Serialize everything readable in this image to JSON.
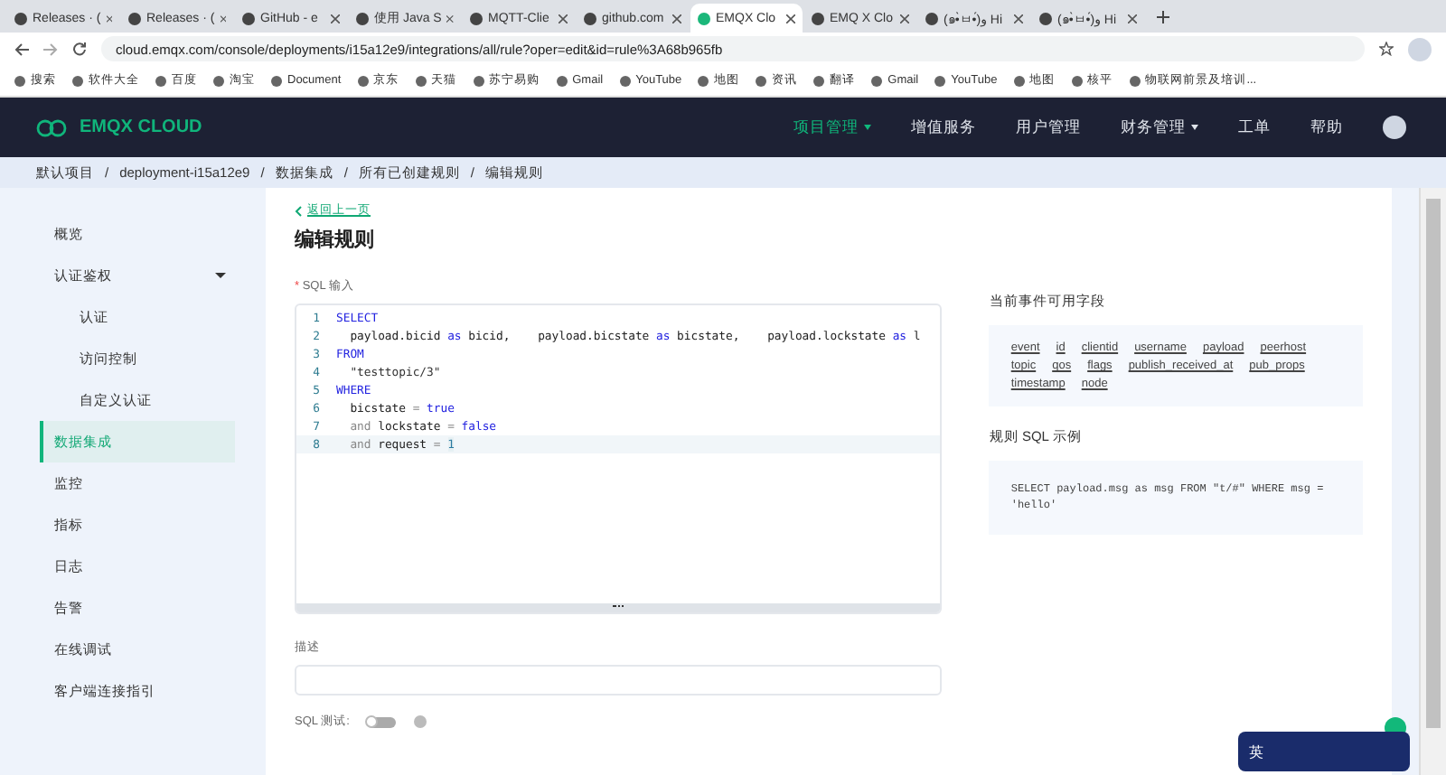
{
  "browser": {
    "tabs": [
      {
        "title": "Releases · (",
        "selected": false
      },
      {
        "title": "Releases · (",
        "selected": false
      },
      {
        "title": "GitHub - e",
        "selected": false
      },
      {
        "title": "使用 Java S",
        "selected": false
      },
      {
        "title": "MQTT-Clie",
        "selected": false
      },
      {
        "title": "github.com",
        "selected": false
      },
      {
        "title": "EMQX Clo",
        "selected": true
      },
      {
        "title": "EMQ X Clo",
        "selected": false
      },
      {
        "title": "(๑•̀ㅂ•́)و Hi",
        "selected": false
      },
      {
        "title": "(๑•̀ㅂ•́)و Hi",
        "selected": false
      }
    ],
    "url": "cloud.emqx.com/console/deployments/i15a12e9/integrations/all/rule?oper=edit&id=rule%3A68b965fb",
    "bookmarks": [
      "搜索",
      "软件大全",
      "百度",
      "淘宝",
      "Document",
      "京东",
      "天猫",
      "苏宁易购",
      "Gmail",
      "YouTube",
      "地图",
      "资讯",
      "翻译",
      "Gmail",
      "YouTube",
      "地图",
      "核平",
      "物联网前景及培训..."
    ]
  },
  "header": {
    "logo": "EMQX CLOUD",
    "nav": [
      {
        "label": "项目管理",
        "selected": true,
        "dropdown": true
      },
      {
        "label": "增值服务",
        "selected": false,
        "dropdown": false
      },
      {
        "label": "用户管理",
        "selected": false,
        "dropdown": false
      },
      {
        "label": "财务管理",
        "selected": false,
        "dropdown": true
      },
      {
        "label": "工单",
        "selected": false,
        "dropdown": false
      },
      {
        "label": "帮助",
        "selected": false,
        "dropdown": false
      }
    ]
  },
  "breadcrumb_separator": "/",
  "breadcrumb": [
    "默认项目",
    "deployment-i15a12e9",
    "数据集成",
    "所有已创建规则",
    "编辑规则"
  ],
  "sidebar": {
    "items": [
      {
        "label": "概览",
        "selected": false
      },
      {
        "label": "认证鉴权",
        "selected": false,
        "expanded": true,
        "children": [
          {
            "label": "认证",
            "selected": false
          },
          {
            "label": "访问控制",
            "selected": false
          },
          {
            "label": "自定义认证",
            "selected": false
          }
        ]
      },
      {
        "label": "数据集成",
        "selected": true
      },
      {
        "label": "监控",
        "selected": false
      },
      {
        "label": "指标",
        "selected": false
      },
      {
        "label": "日志",
        "selected": false
      },
      {
        "label": "告警",
        "selected": false
      },
      {
        "label": "在线调试",
        "selected": false
      },
      {
        "label": "客户端连接指引",
        "selected": false
      }
    ]
  },
  "page": {
    "back_link": "返回上一页",
    "title": "编辑规则",
    "sql_label": "SQL 输入",
    "required_mark": "*",
    "sql_lines": [
      {
        "number": "1",
        "tokens": [
          {
            "text": "SELECT",
            "kind": "keyword"
          }
        ]
      },
      {
        "number": "2",
        "tokens": [
          {
            "text": "  payload.bicid ",
            "kind": "plain"
          },
          {
            "text": "as",
            "kind": "keyword"
          },
          {
            "text": " bicid,    payload.bicstate ",
            "kind": "plain"
          },
          {
            "text": "as",
            "kind": "keyword"
          },
          {
            "text": " bicstate,    payload.lockstate ",
            "kind": "plain"
          },
          {
            "text": "as",
            "kind": "keyword"
          },
          {
            "text": " l",
            "kind": "plain"
          }
        ]
      },
      {
        "number": "3",
        "tokens": [
          {
            "text": "FROM",
            "kind": "keyword"
          }
        ]
      },
      {
        "number": "4",
        "tokens": [
          {
            "text": "  \"testtopic/3\"",
            "kind": "string"
          }
        ]
      },
      {
        "number": "5",
        "tokens": [
          {
            "text": "WHERE",
            "kind": "keyword"
          }
        ]
      },
      {
        "number": "6",
        "tokens": [
          {
            "text": "  bicstate ",
            "kind": "plain"
          },
          {
            "text": "= ",
            "kind": "operator"
          },
          {
            "text": "true",
            "kind": "keyword"
          }
        ]
      },
      {
        "number": "7",
        "tokens": [
          {
            "text": "  and",
            "kind": "operator"
          },
          {
            "text": " lockstate ",
            "kind": "plain"
          },
          {
            "text": "= ",
            "kind": "operator"
          },
          {
            "text": "false",
            "kind": "keyword"
          }
        ]
      },
      {
        "number": "8",
        "tokens": [
          {
            "text": "  and",
            "kind": "operator"
          },
          {
            "text": " request ",
            "kind": "plain"
          },
          {
            "text": "= ",
            "kind": "operator"
          },
          {
            "text": "1",
            "kind": "number"
          }
        ]
      }
    ],
    "description_label": "描述",
    "sql_test_label": "SQL 测试:",
    "sql_test_on": false,
    "fields_title": "当前事件可用字段",
    "fields": [
      "event",
      "id",
      "clientid",
      "username",
      "payload",
      "peerhost",
      "topic",
      "qos",
      "flags",
      "publish_received_at",
      "pub_props",
      "timestamp",
      "node"
    ],
    "example_title": "规则 SQL 示例",
    "example_sql": "SELECT payload.msg as msg FROM \"t/#\" WHERE msg = 'hello'"
  },
  "ime_toolbar": {
    "label": "英"
  }
}
